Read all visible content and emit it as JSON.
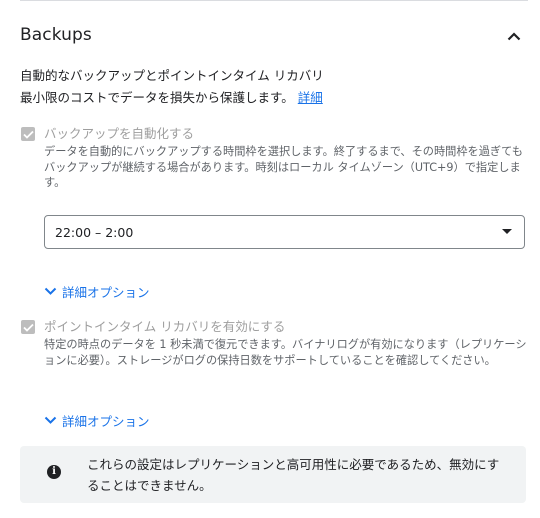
{
  "section": {
    "title": "Backups"
  },
  "intro": {
    "line1": "自動的なバックアップとポイントインタイム リカバリ",
    "line2": "最小限のコストでデータを損失から保護します。",
    "link_label": "詳細"
  },
  "automate_backups": {
    "checked": true,
    "disabled": true,
    "label": "バックアップを自動化する",
    "description": "データを自動的にバックアップする時間枠を選択します。終了するまで、その時間枠を過ぎてもバックアップが継続する場合があります。時刻はローカル タイムゾーン（UTC+9）で指定します。",
    "window_value": "22:00 – 2:00",
    "advanced_label": "詳細オプション"
  },
  "pitr": {
    "checked": true,
    "disabled": true,
    "label": "ポイントインタイム リカバリを有効にする",
    "description": "特定の時点のデータを 1 秒未満で復元できます。バイナリログが有効になります（レプリケーションに必要）。ストレージがログの保持日数をサポートしていることを確認してください。",
    "advanced_label": "詳細オプション"
  },
  "info": {
    "icon": "info-icon",
    "text": "これらの設定はレプリケーションと高可用性に必要であるため、無効にすることはできません。"
  },
  "colors": {
    "accent": "#1a73e8",
    "disabled_checkbox": "#bdbdbd",
    "info_background": "#f1f3f4"
  }
}
